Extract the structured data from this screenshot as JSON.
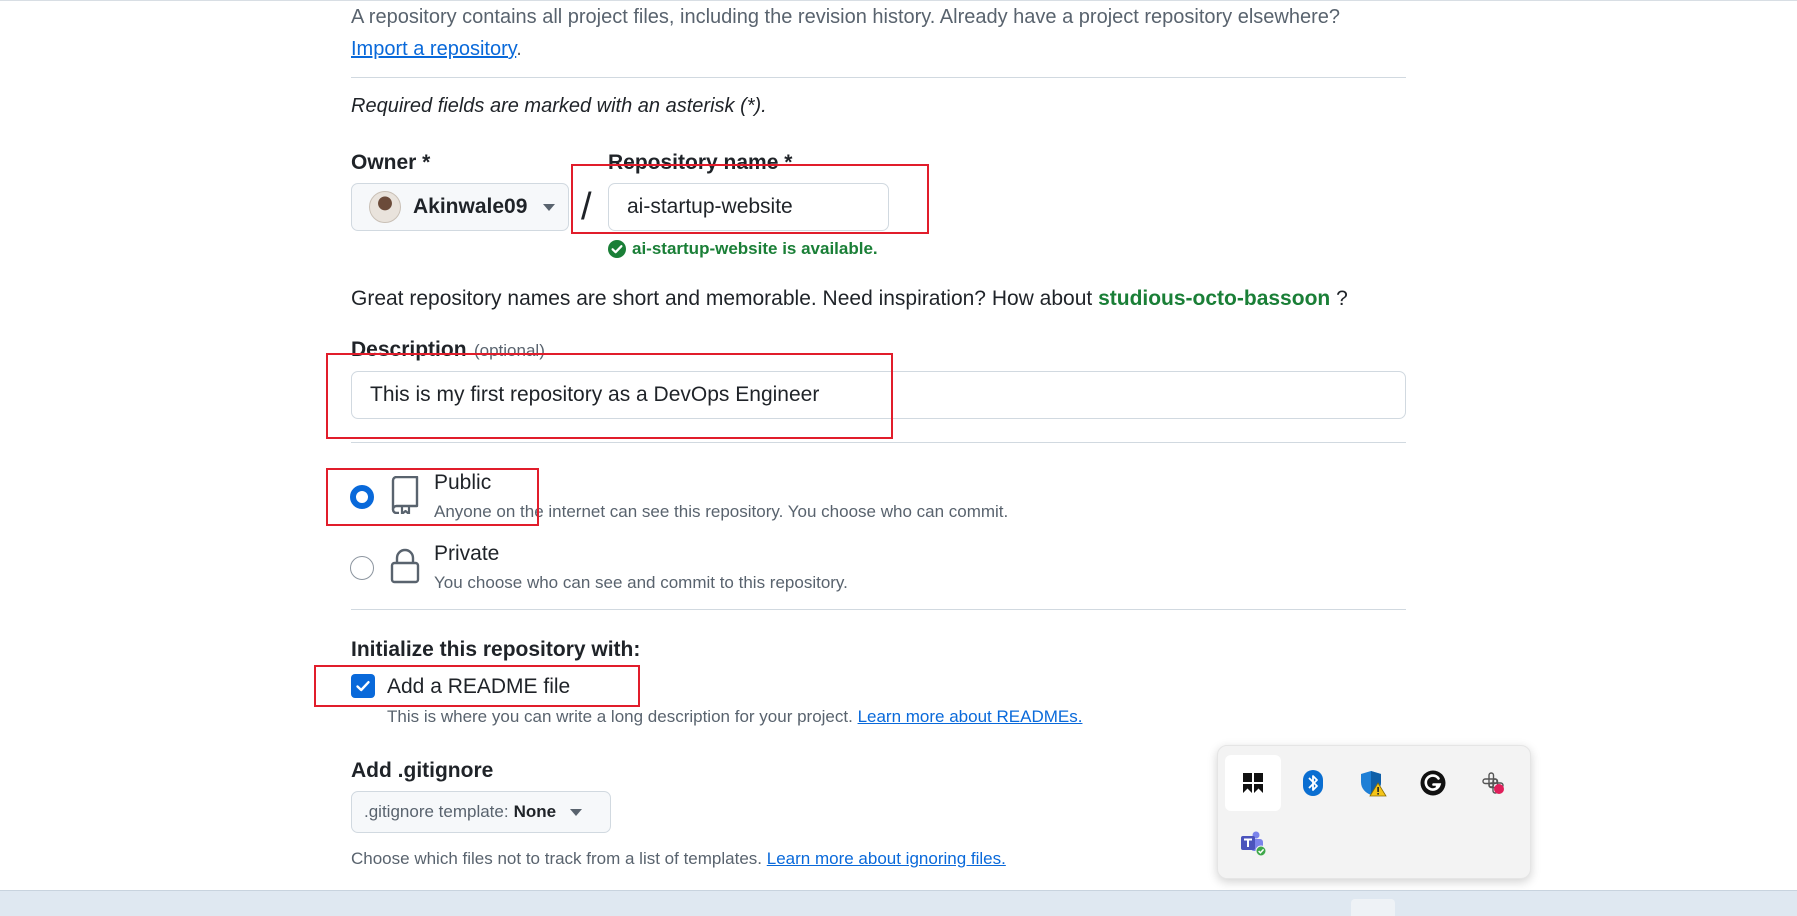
{
  "intro": {
    "text": "A repository contains all project files, including the revision history. Already have a project repository elsewhere?",
    "import_link": "Import a repository",
    "period": "."
  },
  "required_note": "Required fields are marked with an asterisk (*).",
  "owner": {
    "label": "Owner *",
    "value": "Akinwale09"
  },
  "slash": "/",
  "repo_name": {
    "label": "Repository name *",
    "value": "ai-startup-website",
    "availability": "ai-startup-website is available."
  },
  "inspiration": {
    "text": "Great repository names are short and memorable. Need inspiration? How about",
    "suggestion": "studious-octo-bassoon",
    "end": "?"
  },
  "description": {
    "label": "Description",
    "optional": "(optional)",
    "value": "This is my first repository as a DevOps Engineer"
  },
  "visibility": {
    "public": {
      "title": "Public",
      "desc": "Anyone on the internet can see this repository. You choose who can commit.",
      "selected": true
    },
    "private": {
      "title": "Private",
      "desc": "You choose who can see and commit to this repository.",
      "selected": false
    }
  },
  "initialize": {
    "heading": "Initialize this repository with:",
    "readme_label": "Add a README file",
    "readme_checked": true,
    "readme_desc": "This is where you can write a long description for your project.",
    "readme_link": "Learn more about READMEs."
  },
  "gitignore": {
    "heading": "Add .gitignore",
    "template_prefix": ".gitignore template:",
    "template_value": "None",
    "desc": "Choose which files not to track from a list of templates.",
    "link": "Learn more about ignoring files."
  },
  "tray_icons": [
    "app-icon",
    "bluetooth-icon",
    "security-warning-icon",
    "grammarly-icon",
    "slack-icon",
    "teams-icon"
  ],
  "colors": {
    "accent": "#0969da",
    "success": "#1a7f37",
    "annotation": "#e11d2b"
  }
}
